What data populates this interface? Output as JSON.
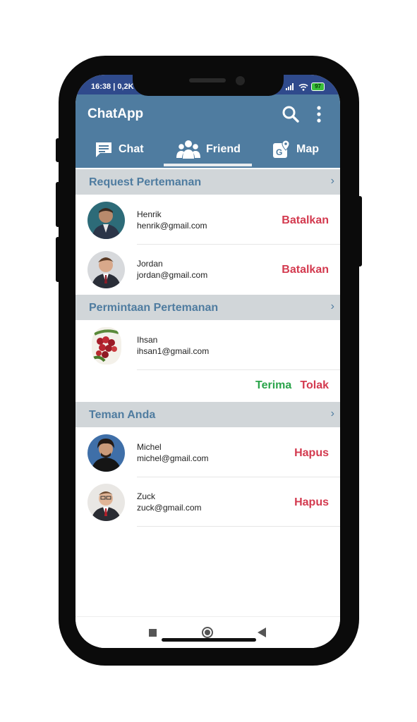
{
  "status_bar": {
    "time": "16:38 | 0,2K",
    "battery": "97"
  },
  "app": {
    "title": "ChatApp"
  },
  "tabs": [
    {
      "label": "Chat",
      "icon": "chat-icon"
    },
    {
      "label": "Friend",
      "icon": "friends-icon",
      "active": true
    },
    {
      "label": "Map",
      "icon": "map-icon"
    }
  ],
  "sections": {
    "request": {
      "title": "Request Pertemanan",
      "items": [
        {
          "name": "Henrik",
          "email": "henrik@gmail.com",
          "action": "Batalkan"
        },
        {
          "name": "Jordan",
          "email": "jordan@gmail.com",
          "action": "Batalkan"
        }
      ]
    },
    "incoming": {
      "title": "Permintaan Pertemanan",
      "items": [
        {
          "name": "Ihsan",
          "email": "ihsan1@gmail.com",
          "accept": "Terima",
          "reject": "Tolak"
        }
      ]
    },
    "friends": {
      "title": "Teman Anda",
      "items": [
        {
          "name": "Michel",
          "email": "michel@gmail.com",
          "action": "Hapus"
        },
        {
          "name": "Zuck",
          "email": "zuck@gmail.com",
          "action": "Hapus"
        }
      ]
    }
  },
  "colors": {
    "primary": "#4f7ca0",
    "status_bar": "#2f4a8c",
    "danger": "#d33a4f",
    "success": "#2aa44a",
    "section_bg": "#d1d6d9"
  }
}
